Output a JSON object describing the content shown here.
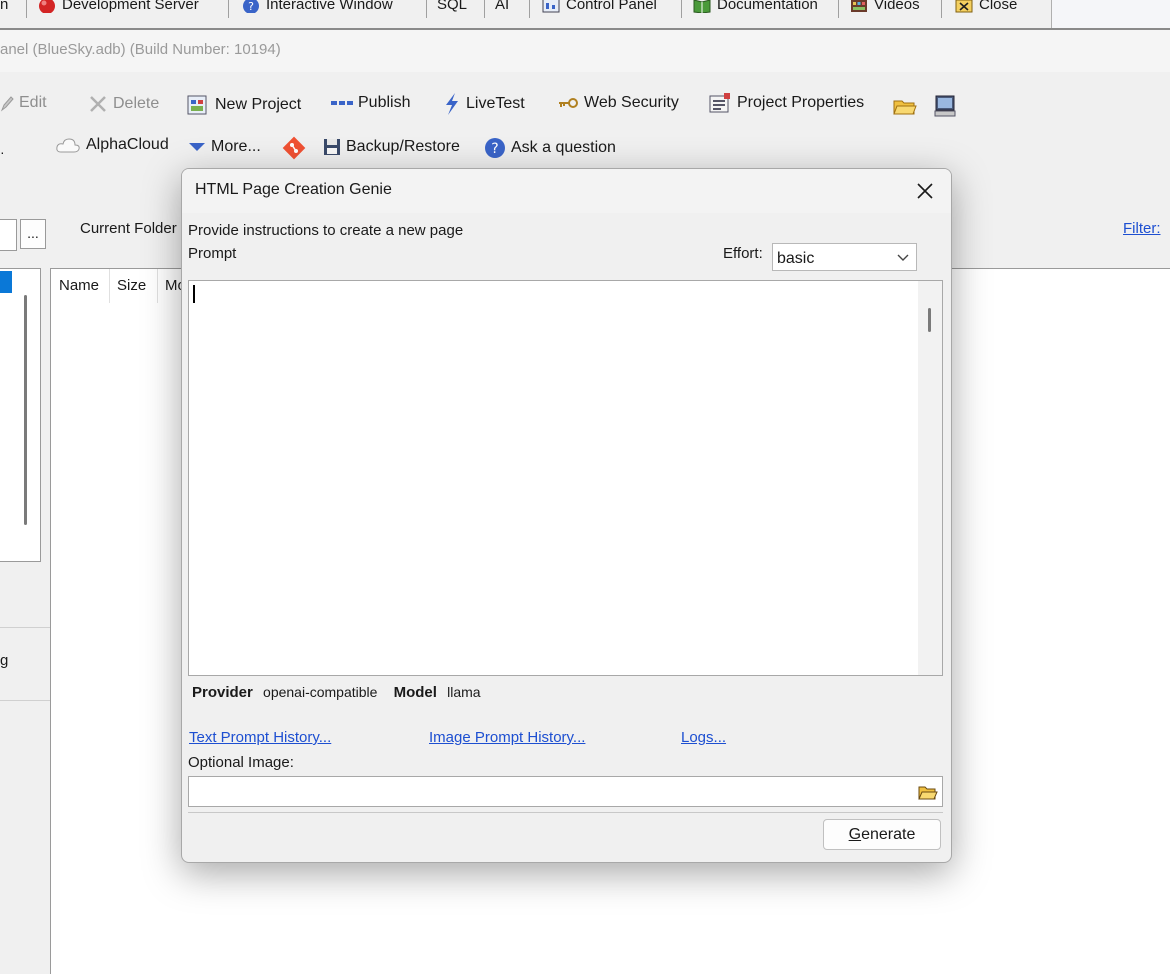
{
  "menubar": {
    "items": [
      {
        "label": "Development Server",
        "icon": "red-circle-icon"
      },
      {
        "label": "Interactive Window",
        "icon": "help-globe-icon"
      },
      {
        "label": "SQL"
      },
      {
        "label": "AI"
      },
      {
        "label": "Control Panel",
        "icon": "control-panel-icon"
      },
      {
        "label": "Documentation",
        "icon": "book-icon"
      },
      {
        "label": "Videos",
        "icon": "film-icon"
      },
      {
        "label": "Close",
        "icon": "close-x-icon"
      }
    ],
    "partial_left": "n"
  },
  "window_title": "anel (BlueSky.adb) (Build Number: 10194)",
  "toolbar": {
    "row1": {
      "edit": "Edit",
      "delete": "Delete",
      "new_project": "New Project",
      "publish": "Publish",
      "livetest": "LiveTest",
      "web_security": "Web Security",
      "project_properties": "Project Properties"
    },
    "row2": {
      "alphacloud": "AlphaCloud",
      "more": "More...",
      "backup_restore": "Backup/Restore",
      "ask_question": "Ask a question"
    },
    "browse_button": "...",
    "current_folder_label": "Current Folder",
    "filter_link": "Filter:"
  },
  "file_list": {
    "columns": [
      "Name",
      "Size",
      "Mo"
    ]
  },
  "left_panel": {
    "partial_text": "g"
  },
  "dialog": {
    "title": "HTML Page Creation Genie",
    "instructions": "Provide instructions to create a new page",
    "prompt_label": "Prompt",
    "effort_label": "Effort:",
    "effort_value": "basic",
    "prompt_value": "",
    "provider_label": "Provider",
    "provider_value": "openai-compatible",
    "model_label": "Model",
    "model_value": "llama",
    "text_history_link": "Text Prompt History...",
    "image_history_link": "Image Prompt History...",
    "logs_link": "Logs...",
    "optional_image_label": "Optional Image:",
    "optional_image_value": "",
    "generate_prefix": "G",
    "generate_rest": "enerate"
  },
  "colors": {
    "link": "#1d4fd1",
    "accent_blue": "#0a78d7"
  }
}
